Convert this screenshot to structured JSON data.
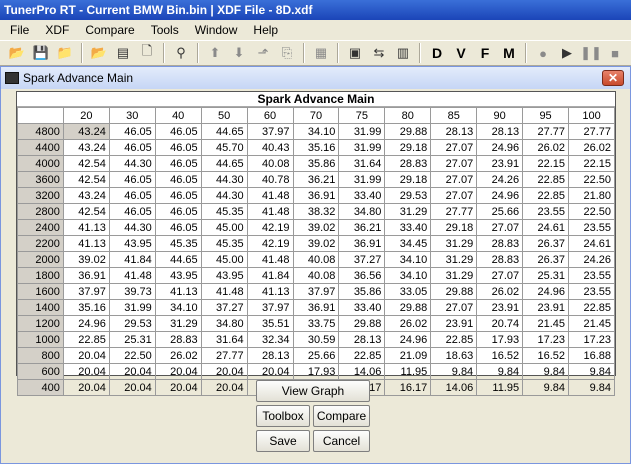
{
  "app": {
    "title": "TunerPro RT - Current BMW Bin.bin | XDF File - 8D.xdf"
  },
  "menu": [
    "File",
    "XDF",
    "Compare",
    "Tools",
    "Window",
    "Help"
  ],
  "toolbar": {
    "letters": [
      "D",
      "V",
      "F",
      "M"
    ]
  },
  "window": {
    "title": "Spark Advance Main",
    "close_label": "✕"
  },
  "table": {
    "title": "Spark Advance Main",
    "columns": [
      "20",
      "30",
      "40",
      "50",
      "60",
      "70",
      "75",
      "80",
      "85",
      "90",
      "95",
      "100"
    ],
    "rows": [
      {
        "label": "4800",
        "values": [
          "43.24",
          "46.05",
          "46.05",
          "44.65",
          "37.97",
          "34.10",
          "31.99",
          "29.88",
          "28.13",
          "28.13",
          "27.77",
          "27.77"
        ]
      },
      {
        "label": "4400",
        "values": [
          "43.24",
          "46.05",
          "46.05",
          "45.70",
          "40.43",
          "35.16",
          "31.99",
          "29.18",
          "27.07",
          "24.96",
          "26.02",
          "26.02"
        ]
      },
      {
        "label": "4000",
        "values": [
          "42.54",
          "44.30",
          "46.05",
          "44.65",
          "40.08",
          "35.86",
          "31.64",
          "28.83",
          "27.07",
          "23.91",
          "22.15",
          "22.15"
        ]
      },
      {
        "label": "3600",
        "values": [
          "42.54",
          "46.05",
          "46.05",
          "44.30",
          "40.78",
          "36.21",
          "31.99",
          "29.18",
          "27.07",
          "24.26",
          "22.85",
          "22.50"
        ]
      },
      {
        "label": "3200",
        "values": [
          "43.24",
          "46.05",
          "46.05",
          "44.30",
          "41.48",
          "36.91",
          "33.40",
          "29.53",
          "27.07",
          "24.96",
          "22.85",
          "21.80"
        ]
      },
      {
        "label": "2800",
        "values": [
          "42.54",
          "46.05",
          "46.05",
          "45.35",
          "41.48",
          "38.32",
          "34.80",
          "31.29",
          "27.77",
          "25.66",
          "23.55",
          "22.50"
        ]
      },
      {
        "label": "2400",
        "values": [
          "41.13",
          "44.30",
          "46.05",
          "45.00",
          "42.19",
          "39.02",
          "36.21",
          "33.40",
          "29.18",
          "27.07",
          "24.61",
          "23.55"
        ]
      },
      {
        "label": "2200",
        "values": [
          "41.13",
          "43.95",
          "45.35",
          "45.35",
          "42.19",
          "39.02",
          "36.91",
          "34.45",
          "31.29",
          "28.83",
          "26.37",
          "24.61"
        ]
      },
      {
        "label": "2000",
        "values": [
          "39.02",
          "41.84",
          "44.65",
          "45.00",
          "41.48",
          "40.08",
          "37.27",
          "34.10",
          "31.29",
          "28.83",
          "26.37",
          "24.26"
        ]
      },
      {
        "label": "1800",
        "values": [
          "36.91",
          "41.48",
          "43.95",
          "43.95",
          "41.84",
          "40.08",
          "36.56",
          "34.10",
          "31.29",
          "27.07",
          "25.31",
          "23.55"
        ]
      },
      {
        "label": "1600",
        "values": [
          "37.97",
          "39.73",
          "41.13",
          "41.48",
          "41.13",
          "37.97",
          "35.86",
          "33.05",
          "29.88",
          "26.02",
          "24.96",
          "23.55"
        ]
      },
      {
        "label": "1400",
        "values": [
          "35.16",
          "31.99",
          "34.10",
          "37.27",
          "37.97",
          "36.91",
          "33.40",
          "29.88",
          "27.07",
          "23.91",
          "23.91",
          "22.85"
        ]
      },
      {
        "label": "1200",
        "values": [
          "24.96",
          "29.53",
          "31.29",
          "34.80",
          "35.51",
          "33.75",
          "29.88",
          "26.02",
          "23.91",
          "20.74",
          "21.45",
          "21.45"
        ]
      },
      {
        "label": "1000",
        "values": [
          "22.85",
          "25.31",
          "28.83",
          "31.64",
          "32.34",
          "30.59",
          "28.13",
          "24.96",
          "22.85",
          "17.93",
          "17.23",
          "17.23"
        ]
      },
      {
        "label": "800",
        "values": [
          "20.04",
          "22.50",
          "26.02",
          "27.77",
          "28.13",
          "25.66",
          "22.85",
          "21.09",
          "18.63",
          "16.52",
          "16.52",
          "16.88"
        ]
      },
      {
        "label": "600",
        "values": [
          "20.04",
          "20.04",
          "20.04",
          "20.04",
          "20.04",
          "17.93",
          "14.06",
          "11.95",
          "9.84",
          "9.84",
          "9.84",
          "9.84"
        ]
      },
      {
        "label": "400",
        "values": [
          "20.04",
          "20.04",
          "20.04",
          "20.04",
          "20.04",
          "17.93",
          "16.17",
          "16.17",
          "14.06",
          "11.95",
          "9.84",
          "9.84"
        ]
      }
    ]
  },
  "buttons": {
    "view_graph": "View Graph",
    "toolbox": "Toolbox",
    "compare": "Compare",
    "save": "Save",
    "cancel": "Cancel"
  }
}
